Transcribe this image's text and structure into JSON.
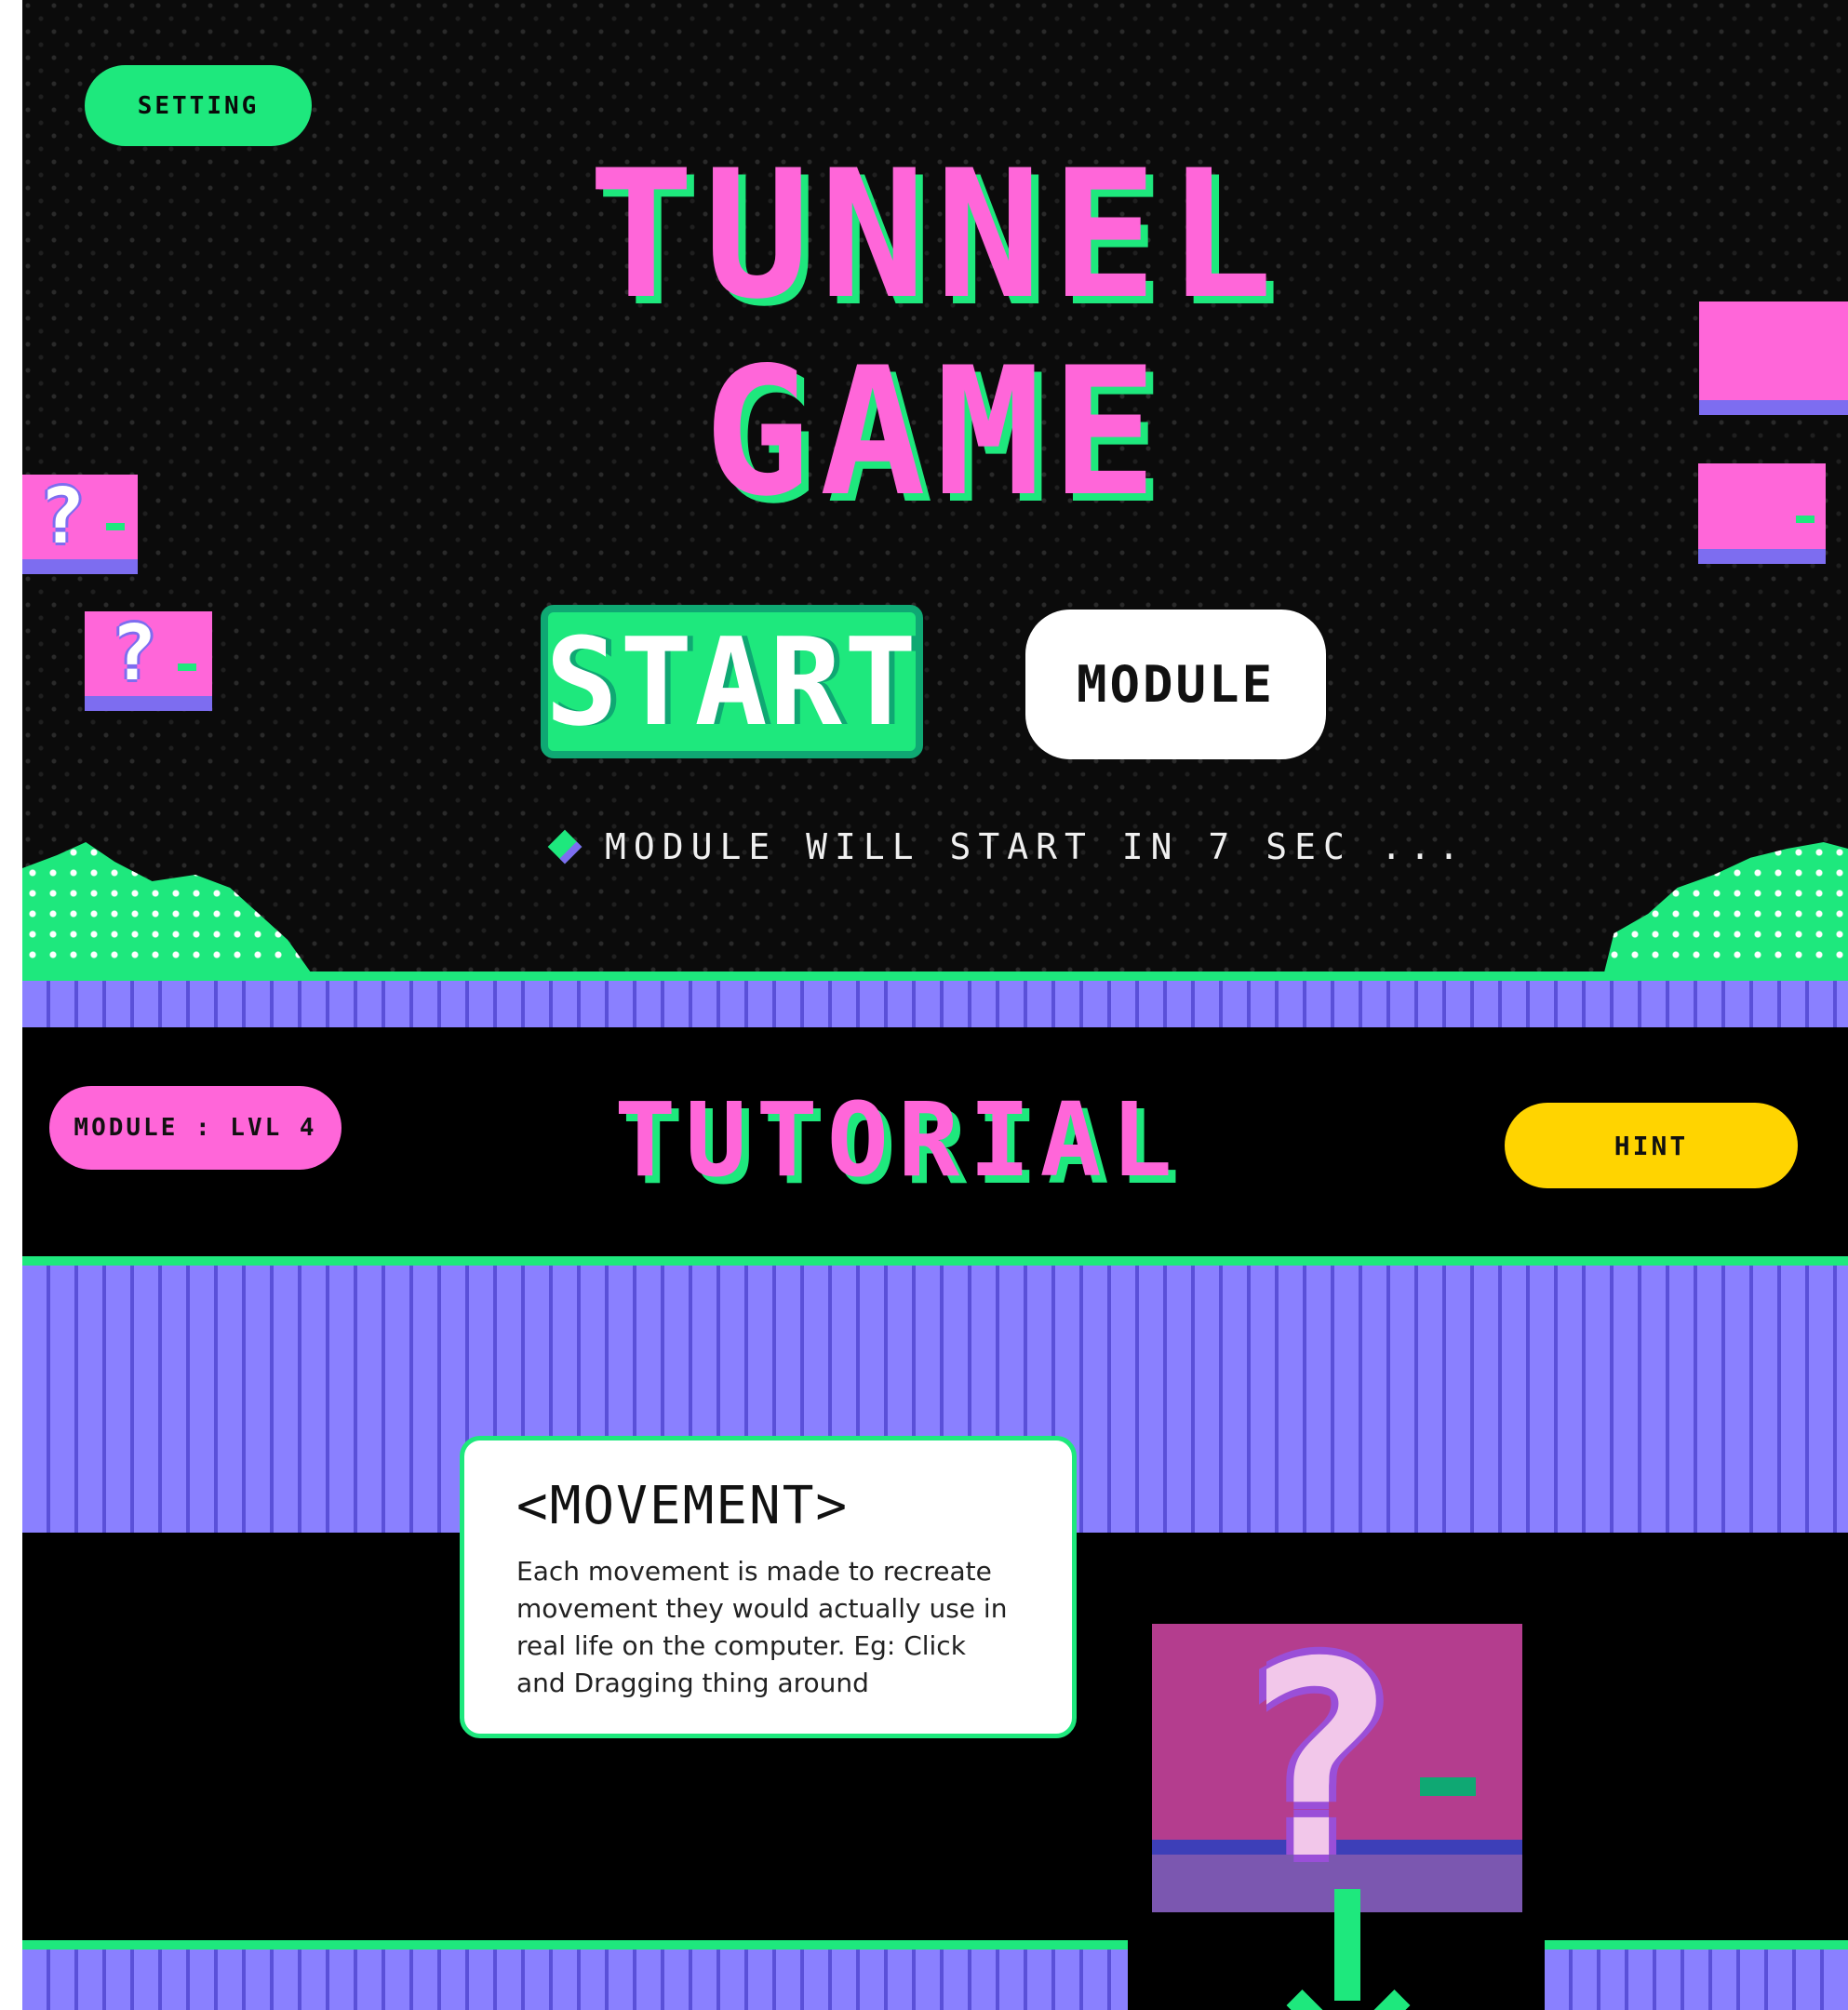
{
  "title_screen": {
    "setting_label": "SETTING",
    "title_line1": "TUNNEL",
    "title_line2": "GAME",
    "start_label": "START",
    "module_label": "MODULE",
    "countdown_text": "MODULE WILL START IN 7 SEC ..."
  },
  "tutorial": {
    "module_level_label": "MODULE : LVL 4",
    "title": "TUTORIAL",
    "hint_label": "HINT",
    "card": {
      "title": "<MOVEMENT>",
      "text": "Each movement is made to recreate movement they would actually use in real life on the computer. Eg: Click and Dragging thing around"
    }
  },
  "icons": {
    "question_block": "?"
  },
  "colors": {
    "pink": "#ff66d9",
    "green": "#1ee87d",
    "purple": "#6f63ea",
    "yellow": "#ffd400",
    "background": "#000000"
  }
}
